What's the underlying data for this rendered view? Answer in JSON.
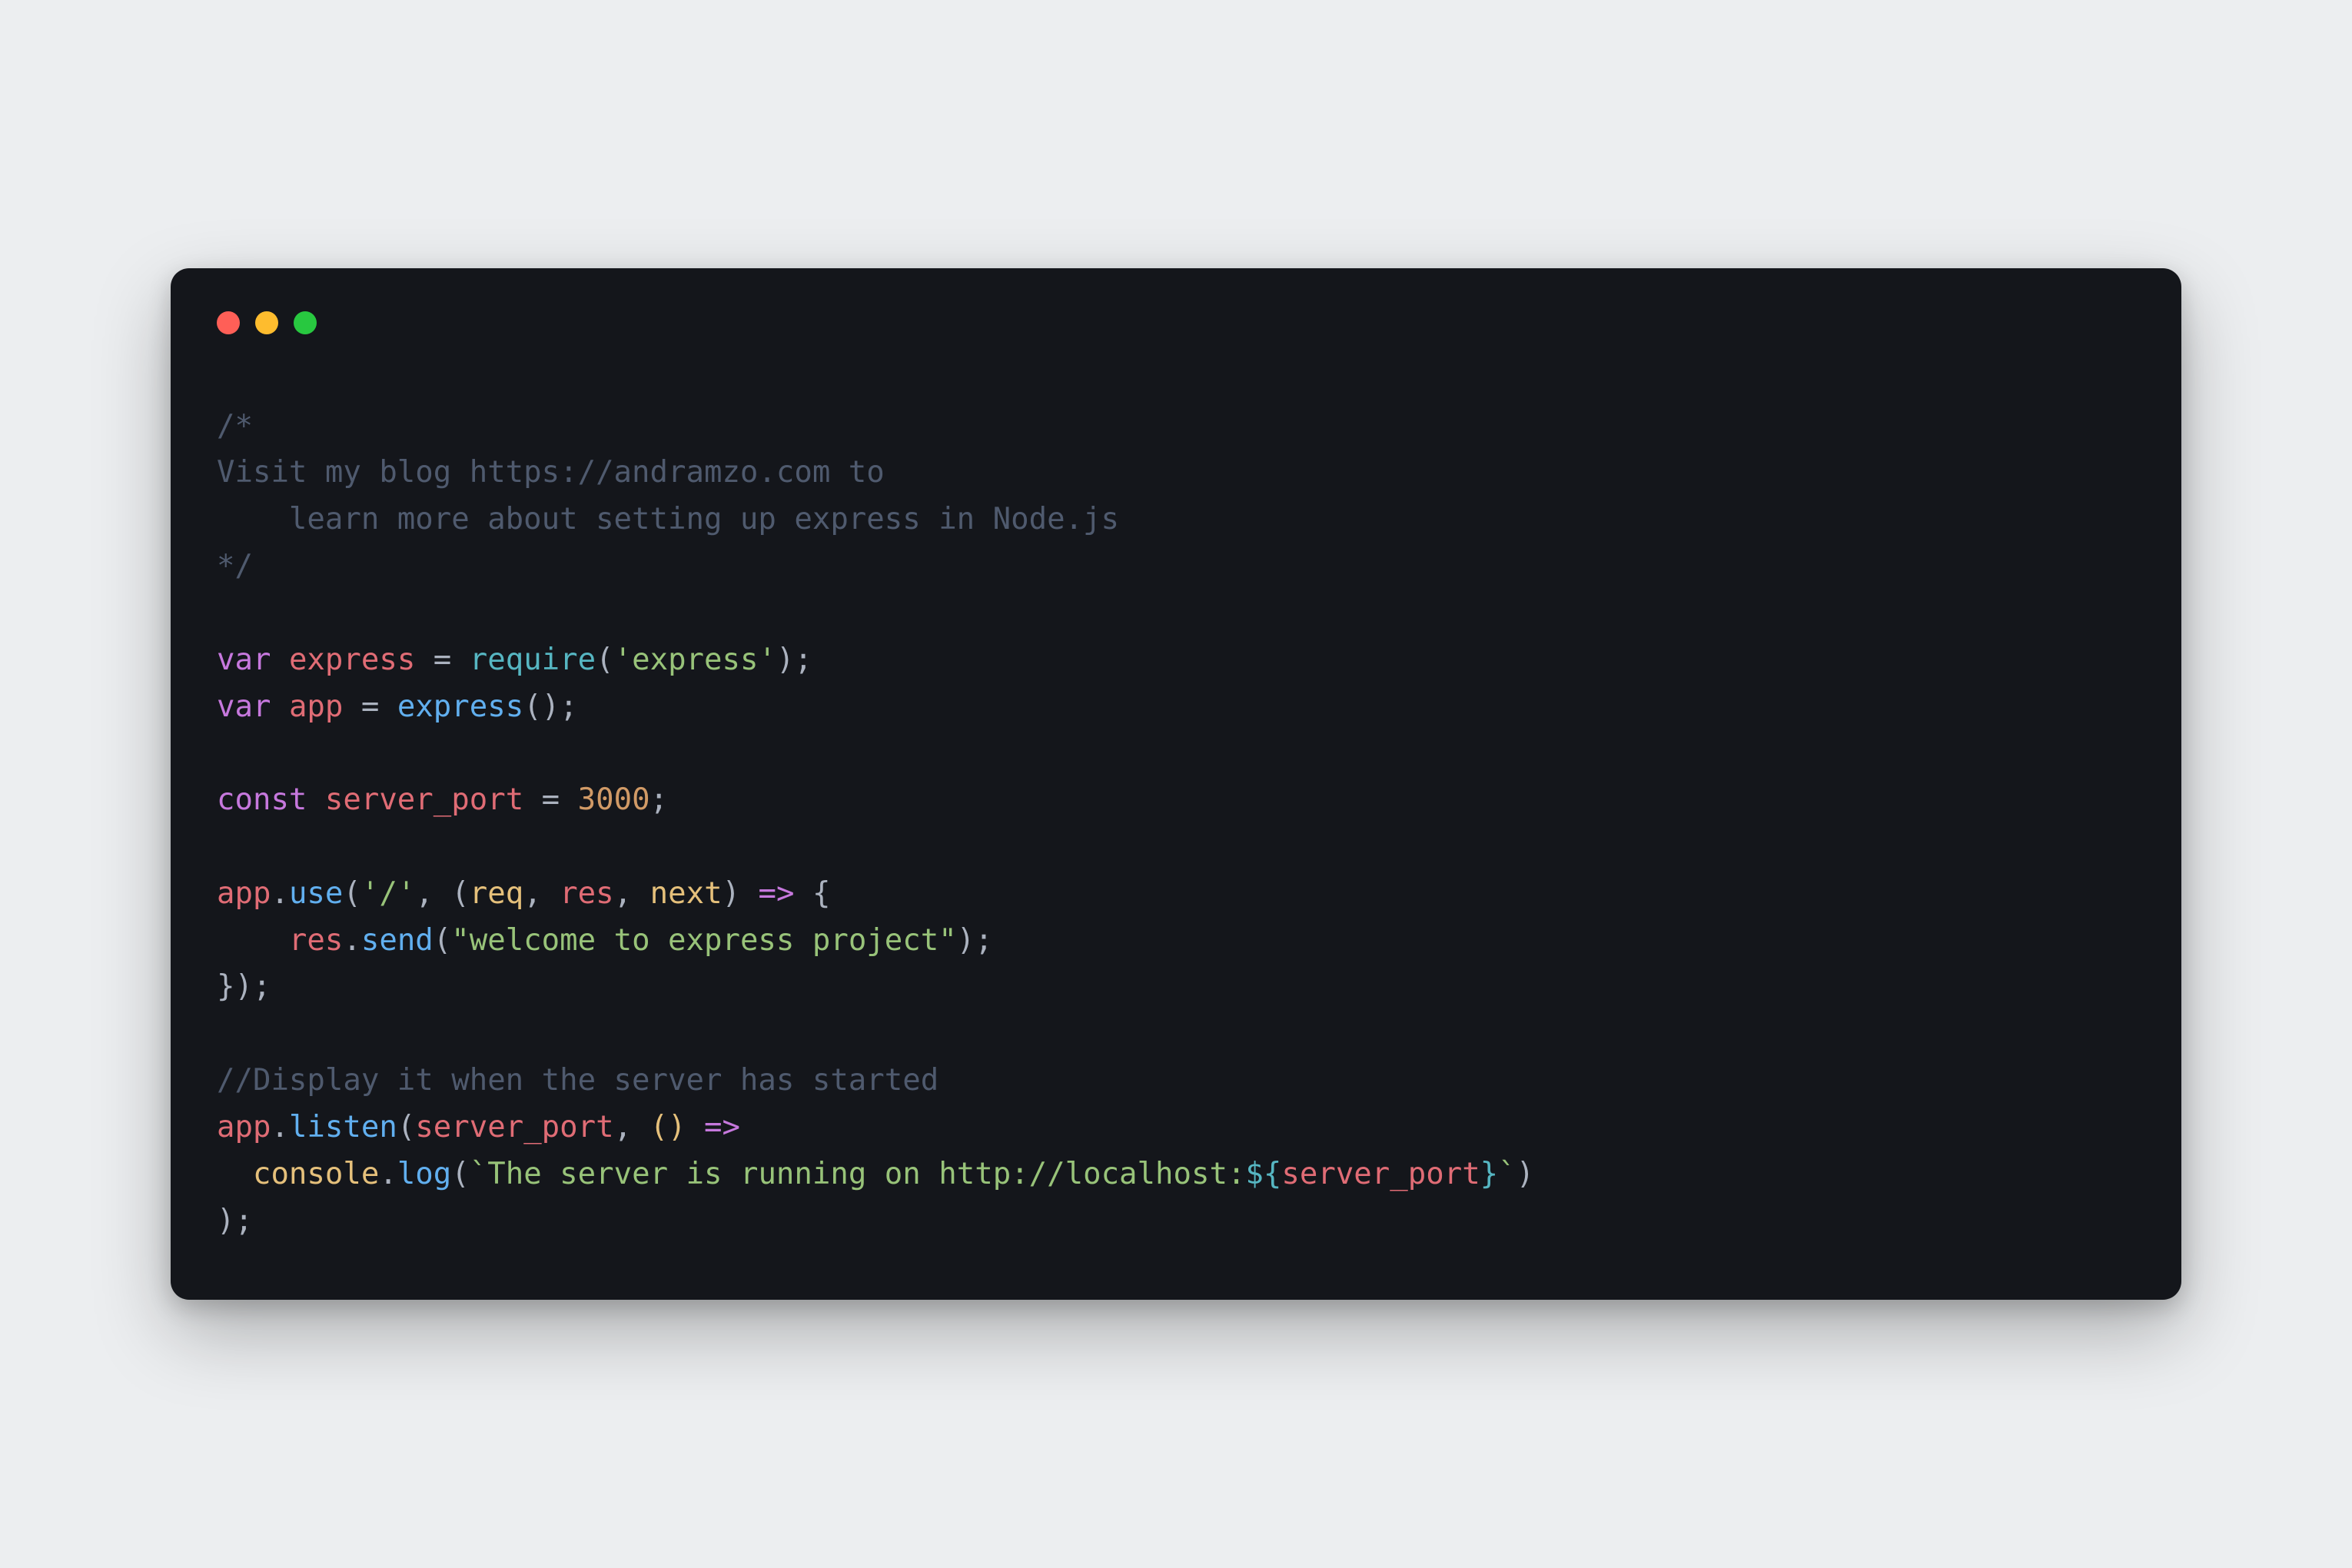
{
  "window": {
    "traffic_lights": {
      "close": "close",
      "minimize": "minimize",
      "zoom": "zoom"
    }
  },
  "code": {
    "l1": "/*",
    "l2": "Visit my blog https://andramzo.com to",
    "l3": "    learn more about setting up express in Node.js",
    "l4": "*/",
    "l5": "",
    "l6_var": "var",
    "l6_name": "express",
    "l6_eq": " = ",
    "l6_require": "require",
    "l6_p1": "(",
    "l6_str": "'express'",
    "l6_p2": ");",
    "l7_var": "var",
    "l7_name": "app",
    "l7_eq": " = ",
    "l7_call": "express",
    "l7_p": "();",
    "l8": "",
    "l9_const": "const",
    "l9_name": "server_port",
    "l9_eq": " = ",
    "l9_num": "3000",
    "l9_semi": ";",
    "l10": "",
    "l11_obj": "app",
    "l11_dot": ".",
    "l11_fn": "use",
    "l11_p1": "(",
    "l11_str": "'/'",
    "l11_comma": ", (",
    "l11_req": "req",
    "l11_c2": ", ",
    "l11_res": "res",
    "l11_c3": ", ",
    "l11_next": "next",
    "l11_p2": ") ",
    "l11_arrow": "=>",
    "l11_brace": " {",
    "l12_indent": "    ",
    "l12_res": "res",
    "l12_dot": ".",
    "l12_fn": "send",
    "l12_p1": "(",
    "l12_str": "\"welcome to express project\"",
    "l12_p2": ");",
    "l13": "});",
    "l14": "",
    "l15": "//Display it when the server has started",
    "l16_obj": "app",
    "l16_dot": ".",
    "l16_fn": "listen",
    "l16_p1": "(",
    "l16_arg": "server_port",
    "l16_c": ", ",
    "l16_paren": "()",
    "l16_sp": " ",
    "l16_arrow": "=>",
    "l17_indent": "  ",
    "l17_console": "console",
    "l17_dot": ".",
    "l17_log": "log",
    "l17_p1": "(",
    "l17_bt1": "`",
    "l17_s1": "The server is running on http://localhost:",
    "l17_d1": "${",
    "l17_var": "server_port",
    "l17_d2": "}",
    "l17_bt2": "`",
    "l17_p2": ")",
    "l18": ");"
  }
}
